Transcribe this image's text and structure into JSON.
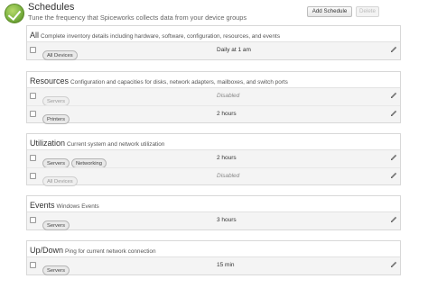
{
  "header": {
    "title": "Schedules",
    "subtitle": "Tune the frequency that Spiceworks collects data from your device groups",
    "add_label": "Add Schedule",
    "delete_label": "Delete"
  },
  "sections": [
    {
      "name": "All",
      "description": "Complete inventory details including hardware, software, configuration, resources, and events",
      "rows": [
        {
          "tags": [
            "All Devices"
          ],
          "frequency": "Daily at 1 am",
          "disabled": false
        }
      ]
    },
    {
      "name": "Resources",
      "description": "Configuration and capacities for disks, network adapters, mailboxes, and switch ports",
      "rows": [
        {
          "tags": [
            "Servers"
          ],
          "frequency": "Disabled",
          "disabled": true
        },
        {
          "tags": [
            "Printers"
          ],
          "frequency": "2 hours",
          "disabled": false
        }
      ]
    },
    {
      "name": "Utilization",
      "description": "Current system and network utilization",
      "rows": [
        {
          "tags": [
            "Servers",
            "Networking"
          ],
          "frequency": "2 hours",
          "disabled": false
        },
        {
          "tags": [
            "All Devices"
          ],
          "frequency": "Disabled",
          "disabled": true
        }
      ]
    },
    {
      "name": "Events",
      "description": "Windows Events",
      "rows": [
        {
          "tags": [
            "Servers"
          ],
          "frequency": "3 hours",
          "disabled": false
        }
      ]
    },
    {
      "name": "Up/Down",
      "description": "Ping for current network connection",
      "rows": [
        {
          "tags": [
            "Servers"
          ],
          "frequency": "15 min",
          "disabled": false
        }
      ]
    }
  ]
}
